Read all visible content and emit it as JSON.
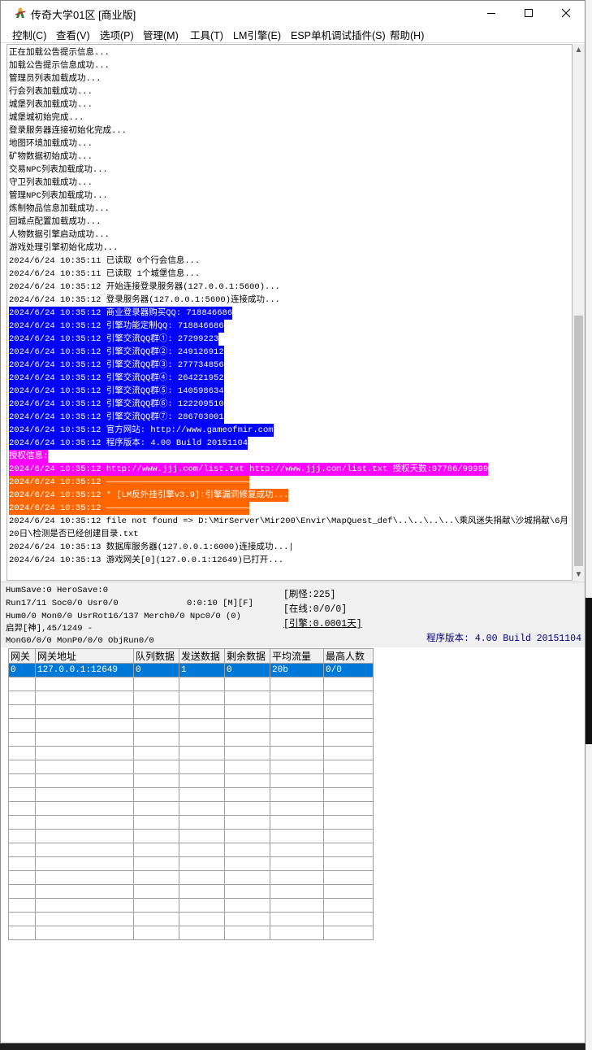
{
  "window": {
    "title": "传奇大学01区 [商业版]"
  },
  "menu": [
    "控制(C)",
    "查看(V)",
    "选项(P)",
    "管理(M)",
    "工具(T)",
    "LM引擎(E)",
    "ESP单机调试插件(S)",
    "帮助(H)"
  ],
  "log_lines": [
    {
      "text": "正在加载公告提示信息...",
      "hl": ""
    },
    {
      "text": "加载公告提示信息成功...",
      "hl": ""
    },
    {
      "text": "管理员列表加载成功...",
      "hl": ""
    },
    {
      "text": "行会列表加载成功...",
      "hl": ""
    },
    {
      "text": "城堡列表加载成功...",
      "hl": ""
    },
    {
      "text": "城堡城初始完成...",
      "hl": ""
    },
    {
      "text": "登录服务器连接初始化完成...",
      "hl": ""
    },
    {
      "text": "地图环境加载成功...",
      "hl": ""
    },
    {
      "text": "矿物数据初始成功...",
      "hl": ""
    },
    {
      "text": "交易NPC列表加载成功...",
      "hl": ""
    },
    {
      "text": "守卫列表加载成功...",
      "hl": ""
    },
    {
      "text": "管理NPC列表加载成功...",
      "hl": ""
    },
    {
      "text": "炼制物品信息加载成功...",
      "hl": ""
    },
    {
      "text": "回城点配置加载成功...",
      "hl": ""
    },
    {
      "text": "人物数据引擎启动成功...",
      "hl": ""
    },
    {
      "text": "游戏处理引擎初始化成功...",
      "hl": ""
    },
    {
      "text": "2024/6/24 10:35:11 已读取 0个行会信息...",
      "hl": ""
    },
    {
      "text": "2024/6/24 10:35:11 已读取 1个城堡信息...",
      "hl": ""
    },
    {
      "text": "2024/6/24 10:35:12 开始连接登录服务器(127.0.0.1:5600)...",
      "hl": ""
    },
    {
      "text": "2024/6/24 10:35:12 登录服务器(127.0.0.1:5600)连接成功...",
      "hl": ""
    },
    {
      "text": "2024/6/24 10:35:12 商业登录器购买QQ: 718846686",
      "hl": "blue"
    },
    {
      "text": "2024/6/24 10:35:12 引擎功能定制QQ: 718846686",
      "hl": "blue"
    },
    {
      "text": "2024/6/24 10:35:12 引擎交流QQ群①: 27299223",
      "hl": "blue"
    },
    {
      "text": "2024/6/24 10:35:12 引擎交流QQ群②: 249126912",
      "hl": "blue"
    },
    {
      "text": "2024/6/24 10:35:12 引擎交流QQ群③: 277734856",
      "hl": "blue"
    },
    {
      "text": "2024/6/24 10:35:12 引擎交流QQ群④: 264221952",
      "hl": "blue"
    },
    {
      "text": "2024/6/24 10:35:12 引擎交流QQ群⑤: 140598634",
      "hl": "blue"
    },
    {
      "text": "2024/6/24 10:35:12 引擎交流QQ群⑥: 122209510",
      "hl": "blue"
    },
    {
      "text": "2024/6/24 10:35:12 引擎交流QQ群⑦: 286703001",
      "hl": "blue"
    },
    {
      "text": "2024/6/24 10:35:12 官方网站: http://www.gameofmir.com",
      "hl": "blue"
    },
    {
      "text": "2024/6/24 10:35:12 程序版本: 4.00 Build 20151104",
      "hl": "blue"
    },
    {
      "text": "授权信息:",
      "hl": "mag"
    },
    {
      "text": "2024/6/24 10:35:12 http://www.jjj.com/list.txt http://www.jjj.com/list.txt 授权天数:97786/99999",
      "hl": "mag"
    },
    {
      "text": "2024/6/24 10:35:12 ————————————————————————————",
      "hl": "orange"
    },
    {
      "text": "2024/6/24 10:35:12 * [LM反外挂引擎v3.9]:引擎漏洞修复成功...",
      "hl": "orange"
    },
    {
      "text": "2024/6/24 10:35:12 ————————————————————————————",
      "hl": "orange"
    },
    {
      "text": "2024/6/24 10:35:12 file not found => D:\\MirServer\\Mir200\\Envir\\MapQuest_def\\..\\..\\..\\..\\乘风迷失捐献\\沙城捐献\\6月",
      "hl": ""
    },
    {
      "text": "20日\\检测是否已经创建目录.txt",
      "hl": ""
    },
    {
      "text": "2024/6/24 10:35:13 数据库服务器(127.0.0.1:6000)连接成功...|",
      "hl": ""
    },
    {
      "text": "2024/6/24 10:35:13 游戏网关[0](127.0.0.1:12649)已打开...",
      "hl": ""
    }
  ],
  "status": {
    "line1": "HumSave:0 HeroSave:0",
    "line2a": "Run17/11 Soc0/0 Usr0/0",
    "line2b": "0:0:10 [M][F]",
    "line3": "Hum0/0 Mon0/0 UsrRot16/137 Merch0/0 Npc0/0 (0)",
    "line4": "启羿[神],45/1249 -",
    "line5": "MonG0/0/0 MonP0/0/0 ObjRun0/0",
    "refresh": "[刷怪:225]",
    "online": "[在线:0/0/0]",
    "engine": "[引擎:0.0001天]",
    "version": "程序版本: 4.00 Build 20151104"
  },
  "table": {
    "headers": [
      "网关",
      "网关地址",
      "队列数据",
      "发送数据",
      "剩余数据",
      "平均流量",
      "最高人数"
    ],
    "rows": [
      [
        "0",
        "127.0.0.1:12649",
        "0",
        "1",
        "0",
        "20b",
        "0/0"
      ]
    ],
    "empty_rows": 19
  }
}
